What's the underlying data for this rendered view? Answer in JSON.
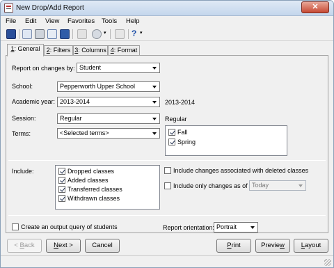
{
  "window": {
    "title": "New Drop/Add Report",
    "close_label": "✕"
  },
  "menu": [
    "File",
    "Edit",
    "View",
    "Favorites",
    "Tools",
    "Help"
  ],
  "toolbar": {
    "help_label": "?"
  },
  "tabs": [
    {
      "key": "1",
      "label": ": General"
    },
    {
      "key": "2",
      "label": ": Filters"
    },
    {
      "key": "3",
      "label": ": Columns"
    },
    {
      "key": "4",
      "label": ": Format"
    }
  ],
  "general": {
    "report_on_label": "Report on changes by:",
    "report_on_value": "Student",
    "school_label": "School:",
    "school_value": "Pepperworth Upper School",
    "year_label": "Academic year:",
    "year_value": "2013-2014",
    "year_display": "2013-2014",
    "session_label": "Session:",
    "session_value": "Regular",
    "session_display": "Regular",
    "terms_label": "Terms:",
    "terms_value": "<Selected terms>",
    "terms_list": [
      {
        "label": "Fall",
        "checked": true
      },
      {
        "label": "Spring",
        "checked": true
      }
    ],
    "include_label": "Include:",
    "include_list": [
      {
        "label": "Dropped classes",
        "checked": true
      },
      {
        "label": "Added classes",
        "checked": true
      },
      {
        "label": "Transferred classes",
        "checked": true
      },
      {
        "label": "Withdrawn classes",
        "checked": true
      }
    ],
    "deleted_classes_label": "Include changes associated with deleted classes",
    "deleted_classes_checked": false,
    "only_changes_label": "Include only changes as of",
    "only_changes_checked": false,
    "as_of_value": "Today",
    "output_query_label": "Create an output query of students",
    "output_query_checked": false,
    "orientation_label": "Report orientation:",
    "orientation_value": "Portrait"
  },
  "buttons": {
    "back": {
      "key": "B",
      "rest": "ack",
      "prefix": "< "
    },
    "next": {
      "key": "N",
      "rest": "ext >"
    },
    "cancel": "Cancel",
    "print": {
      "key": "P",
      "rest": "rint"
    },
    "preview": {
      "pre": "Previe",
      "key": "w"
    },
    "layout": {
      "key": "L",
      "rest": "ayout"
    }
  },
  "colors": {
    "titlebar": "#c4d6ec",
    "close": "#c74a34",
    "panel": "#f0f0f0"
  }
}
